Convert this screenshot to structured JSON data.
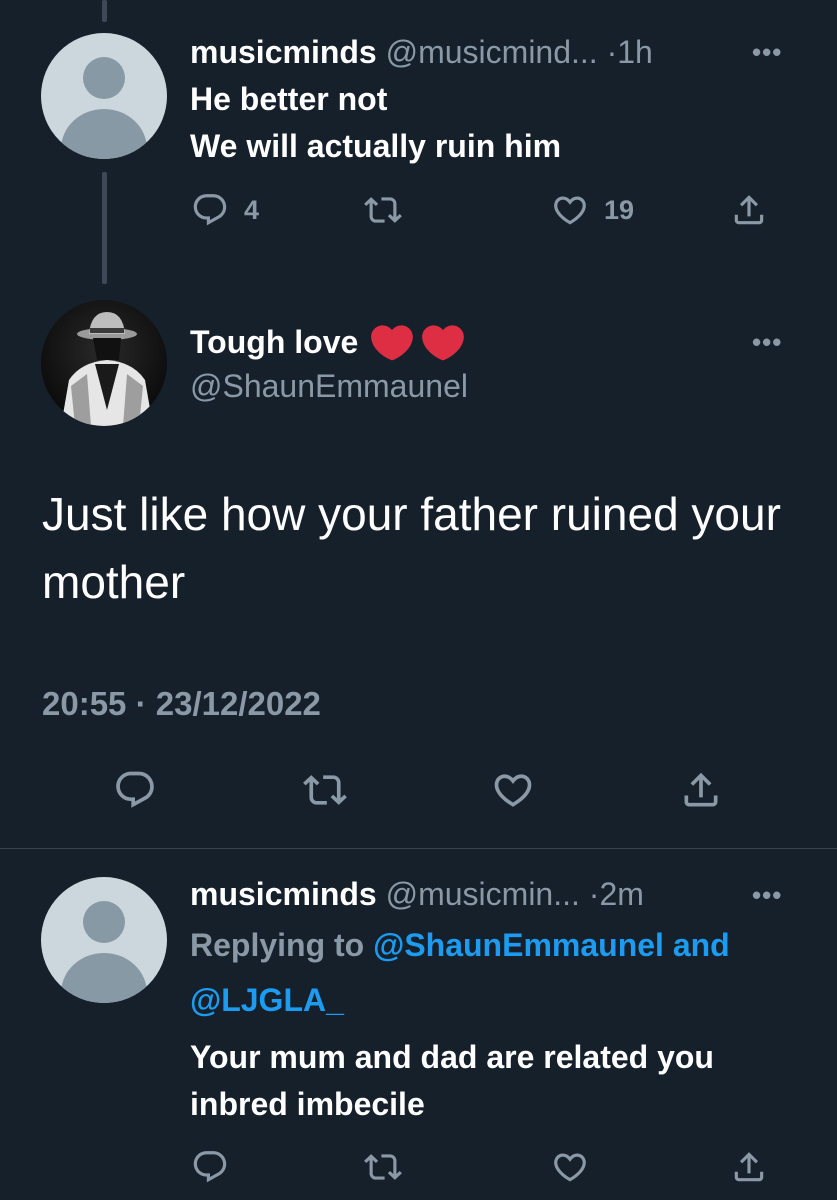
{
  "tweets": [
    {
      "display_name": "musicminds",
      "handle": "@musicmind...",
      "separator": "·",
      "time": "1h",
      "text_lines": [
        "He better not",
        "We will actually ruin him"
      ],
      "reply_count": "4",
      "like_count": "19"
    }
  ],
  "focused": {
    "display_name": "Tough love",
    "handle": "@ShaunEmmaunel",
    "text": "Just like how your father ruined your mother",
    "time": "20:55",
    "separator": "·",
    "date": "23/12/2022"
  },
  "reply": {
    "display_name": "musicminds",
    "handle": "@musicmin...",
    "separator": "·",
    "time": "2m",
    "replying_prefix": "Replying to ",
    "replying_to_1": "@ShaunEmmaunel",
    "replying_and": " and",
    "replying_to_2": "@LJGLA_",
    "text_line_1": "Your mum and dad are related you",
    "text_line_2": "inbred imbecile"
  },
  "icons": {
    "reply": "reply-icon",
    "retweet": "retweet-icon",
    "like": "heart-icon",
    "share": "share-icon",
    "more": "more-icon"
  },
  "colors": {
    "background": "#15202b",
    "text": "#ffffff",
    "muted": "#8b98a5",
    "link": "#1d9bf0",
    "emoji_heart": "#e0245e"
  }
}
